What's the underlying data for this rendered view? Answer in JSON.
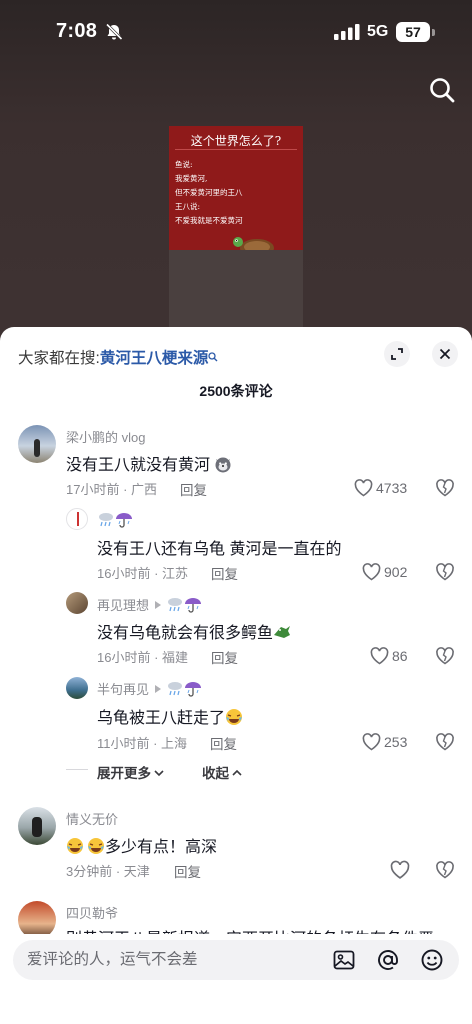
{
  "status": {
    "time": "7:08",
    "network": "5G",
    "battery": "57"
  },
  "video": {
    "card_title": "这个世界怎么了?",
    "card_body": "鱼说:\n我爱黄河,\n但不爱黄河里的王八\n王八说:\n不爱我就是不爱黄河"
  },
  "panel": {
    "hot_search_prefix": "大家都在搜:",
    "hot_search_keyword": "黄河王八梗来源",
    "comment_count": "2500条评论"
  },
  "comments": [
    {
      "user": "梁小鹏的 vlog",
      "text": "没有王八就没有黄河",
      "meta": "17小时前 · 广西",
      "reply": "回复",
      "likes": "4733"
    },
    {
      "user": "",
      "text": "没有王八还有乌龟 黄河是一直在的",
      "meta": "16小时前 · 江苏",
      "reply": "回复",
      "likes": "902"
    },
    {
      "user": "再见理想",
      "text": "没有乌龟就会有很多鳄鱼",
      "meta": "16小时前 · 福建",
      "reply": "回复",
      "likes": "86"
    },
    {
      "user": "半句再见",
      "text": "乌龟被王八赶走了",
      "meta": "11小时前 · 上海",
      "reply": "回复",
      "likes": "253"
    },
    {
      "user": "情义无价",
      "text": "多少有点！高深",
      "meta": "3分钟前 · 天津",
      "reply": "回复",
      "likes": ""
    },
    {
      "user": "四贝勒爷",
      "text": "别黄河王八最新报道：安西开比河的各杆生有各件严",
      "meta": "",
      "reply": "",
      "likes": ""
    }
  ],
  "thread": {
    "expand_label": "展开更多",
    "collapse_label": "收起"
  },
  "input": {
    "placeholder": "爱评论的人，运气不会差"
  },
  "colors": {
    "keyword": "#2c5aa8",
    "panel_bg": "#ffffff",
    "video_bg": "#3b2f2f"
  }
}
